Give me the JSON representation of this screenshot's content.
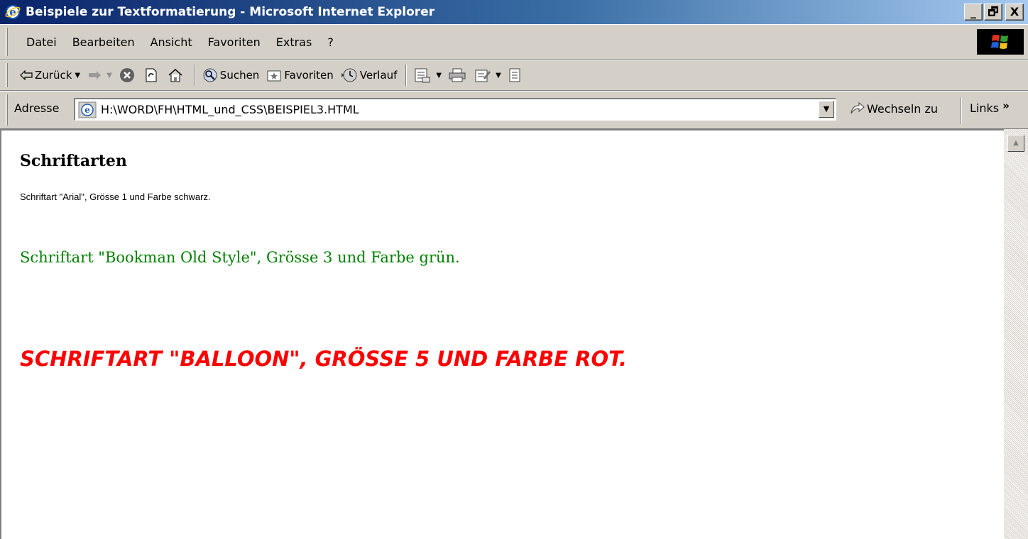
{
  "window": {
    "title": "Beispiele zur Textformatierung - Microsoft Internet Explorer",
    "minimize": "_",
    "maximize": "🗗",
    "close": "X"
  },
  "menu": [
    "Datei",
    "Bearbeiten",
    "Ansicht",
    "Favoriten",
    "Extras",
    "?"
  ],
  "toolbar": {
    "back": "Zurück",
    "search": "Suchen",
    "favorites": "Favoriten",
    "history": "Verlauf"
  },
  "address": {
    "label": "Adresse",
    "value": "H:\\WORD\\FH\\HTML_und_CSS\\BEISPIEL3.HTML",
    "go": "Wechseln zu",
    "links": "Links"
  },
  "content": {
    "heading": "Schriftarten",
    "paragraph_arial": "Schriftart \"Arial\", Grösse 1 und Farbe schwarz.",
    "paragraph_bookman": "Schriftart \"Bookman Old Style\", Grösse 3 und Farbe grün.",
    "paragraph_balloon": "Schriftart \"Balloon\", Grösse 5 und Farbe rot."
  },
  "colors": {
    "title_gradient_start": "#0a246a",
    "title_gradient_end": "#a6caf0",
    "chrome": "#d4d0c8",
    "green_text": "#008000",
    "red_text": "#ff0000"
  }
}
